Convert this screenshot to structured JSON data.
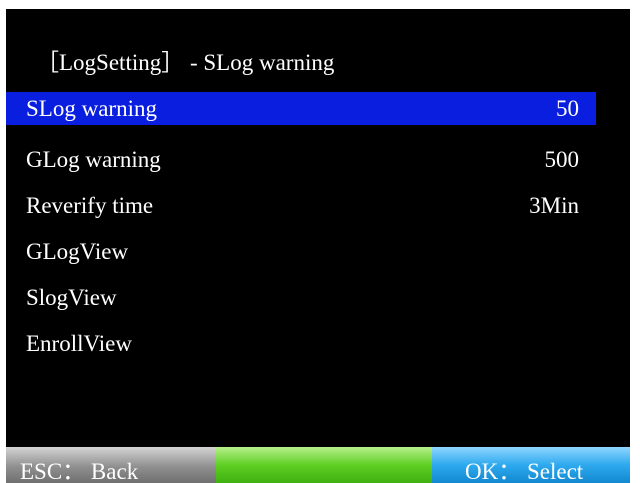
{
  "title": "［LogSetting］ - SLog warning",
  "menu": {
    "items": [
      {
        "label": "SLog warning",
        "value": "50"
      },
      {
        "label": "GLog warning",
        "value": "500"
      },
      {
        "label": "Reverify time",
        "value": "3Min"
      },
      {
        "label": "GLogView",
        "value": ""
      },
      {
        "label": "SlogView",
        "value": ""
      },
      {
        "label": "EnrollView",
        "value": ""
      }
    ],
    "selected_index": 0
  },
  "footer": {
    "left_label": "ESC： Back",
    "right_label": "OK： Select"
  },
  "colors": {
    "screen_background": "#000000",
    "selection_highlight": "#0a1ee0",
    "esc_button": "#8f8f8f",
    "middle_button": "#5fcf24",
    "ok_button": "#2ea9ee",
    "text": "#ffffff"
  }
}
